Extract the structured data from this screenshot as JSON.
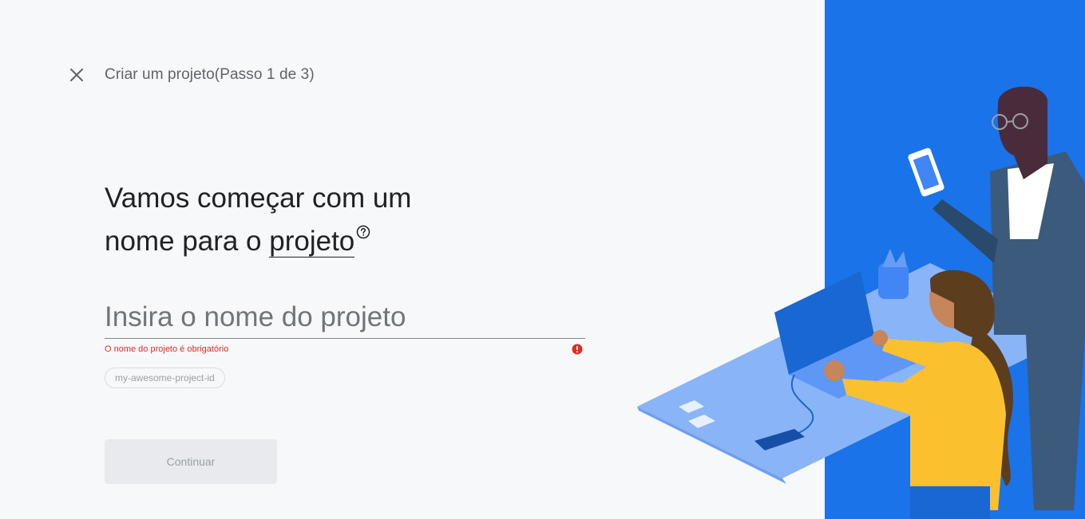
{
  "header": {
    "close_icon": "close-icon",
    "title": "Criar um projeto(Passo 1 de 3)"
  },
  "headline": {
    "line1": "Vamos começar com um",
    "line2_prefix": "nome para o ",
    "term": "projeto",
    "help_icon": "help-circle-icon"
  },
  "form": {
    "project_name_placeholder": "Insira o nome do projeto",
    "project_name_value": "",
    "error_message": "O nome do projeto é obrigatório",
    "error_icon": "error-icon",
    "project_id_chip": "my-awesome-project-id"
  },
  "actions": {
    "continue_label": "Continuar"
  },
  "colors": {
    "accent_blue": "#1a73e8",
    "error_red": "#d93025",
    "text_primary": "#202124",
    "text_secondary": "#5f6368",
    "disabled_bg": "#e8eaed",
    "disabled_text": "#9aa0a6"
  }
}
